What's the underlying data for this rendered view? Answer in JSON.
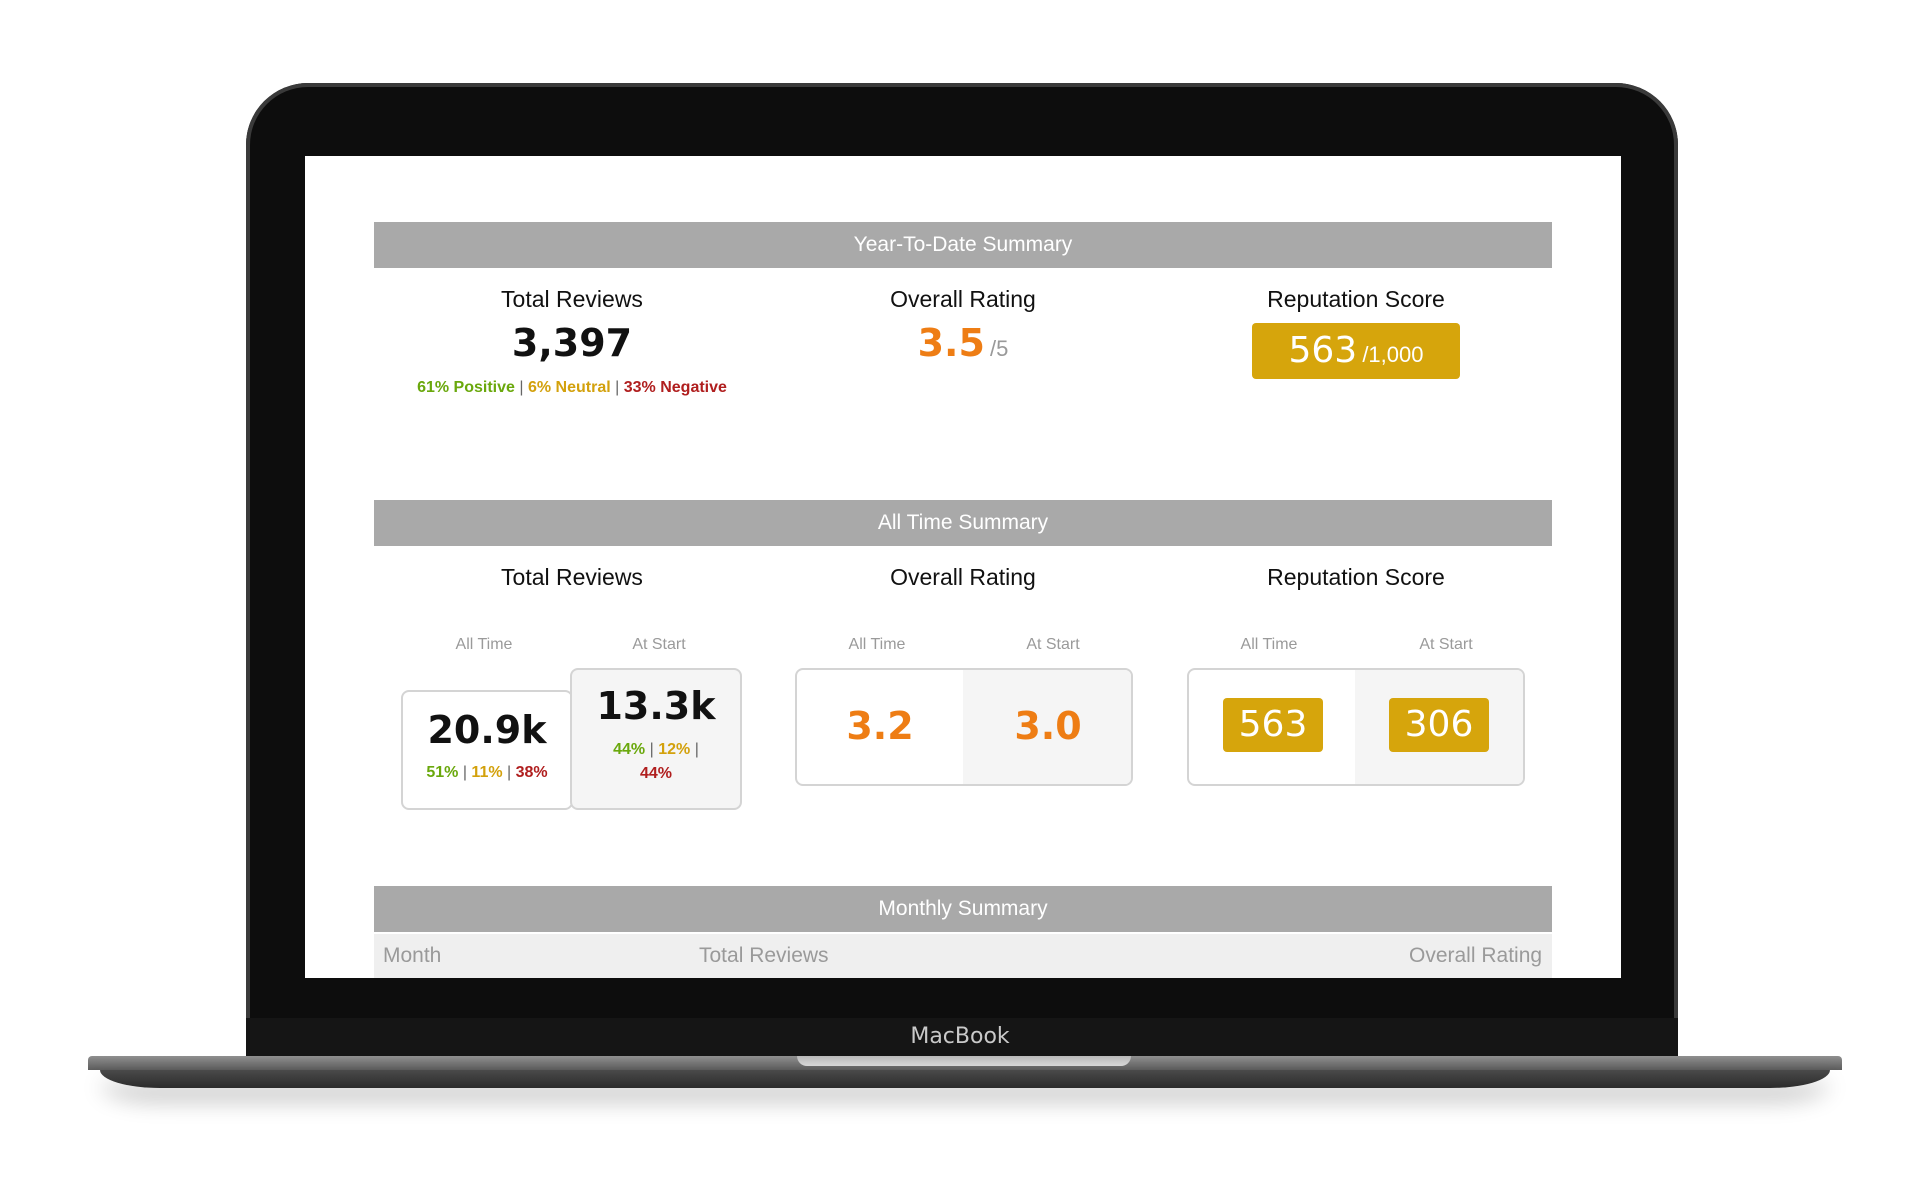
{
  "device": {
    "brand": "MacBook"
  },
  "ytd": {
    "header": "Year-To-Date Summary",
    "total_reviews": {
      "title": "Total Reviews",
      "value": "3,397",
      "positive_pct": "61%",
      "positive_label": "Positive",
      "neutral_pct": "6%",
      "neutral_label": "Neutral",
      "negative_pct": "33%",
      "negative_label": "Negative"
    },
    "overall_rating": {
      "title": "Overall Rating",
      "value": "3.5",
      "scale": "/5"
    },
    "reputation_score": {
      "title": "Reputation Score",
      "value": "563",
      "scale": "/1,000"
    }
  },
  "all_time": {
    "header": "All Time Summary",
    "label_all_time": "All Time",
    "label_at_start": "At Start",
    "total_reviews": {
      "title": "Total Reviews",
      "all_time": {
        "value": "20.9k",
        "positive": "51%",
        "neutral": "11%",
        "negative": "38%"
      },
      "at_start": {
        "value": "13.3k",
        "positive": "44%",
        "neutral": "12%",
        "negative": "44%"
      }
    },
    "overall_rating": {
      "title": "Overall Rating",
      "all_time": "3.2",
      "at_start": "3.0"
    },
    "reputation_score": {
      "title": "Reputation Score",
      "all_time": "563",
      "at_start": "306"
    }
  },
  "monthly": {
    "header": "Monthly Summary",
    "columns": [
      "Month",
      "Total Reviews",
      "Overall Rating"
    ]
  },
  "colors": {
    "positive": "#6aa80c",
    "neutral": "#d3a10c",
    "negative": "#b01e1e",
    "rating": "#ee7d14",
    "score_badge": "#d6a50c",
    "section_header": "#a9a9a9"
  }
}
